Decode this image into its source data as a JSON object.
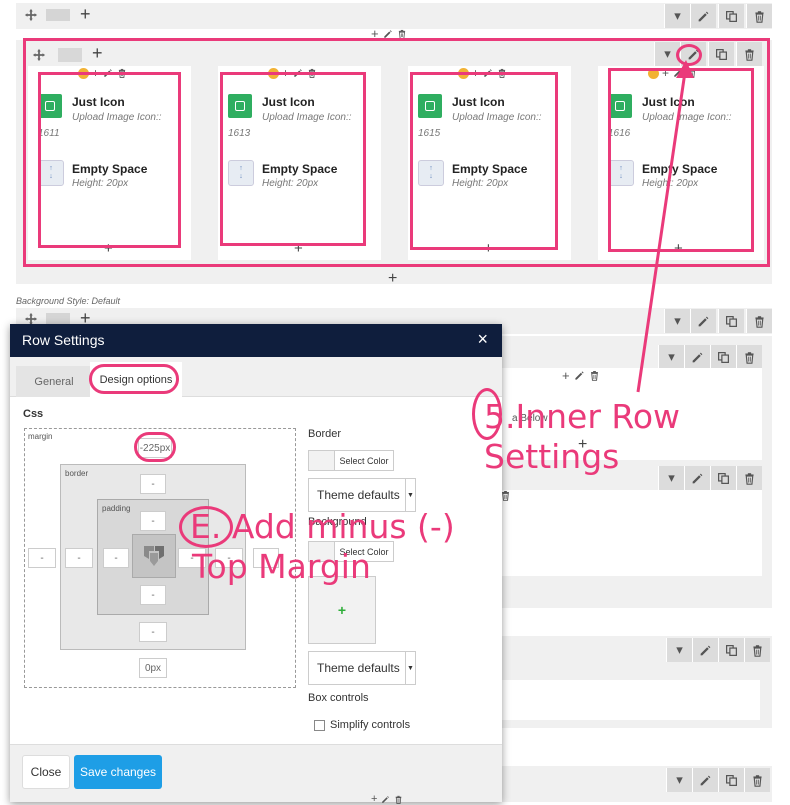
{
  "section_title": "Background Style: Default",
  "row_controls": {
    "add": "+",
    "dropdown": "▾",
    "move_icon": "move-icon",
    "pencil_icon": "pencil-icon",
    "copy_icon": "copy-icon",
    "trash_icon": "trash-icon"
  },
  "columns": [
    {
      "el1_title": "Just Icon",
      "el1_sub": "Upload Image Icon::",
      "el1_id": "1611",
      "el2_title": "Empty Space",
      "el2_sub": "Height: 20px"
    },
    {
      "el1_title": "Just Icon",
      "el1_sub": "Upload Image Icon::",
      "el1_id": "1613",
      "el2_title": "Empty Space",
      "el2_sub": "Height: 20px"
    },
    {
      "el1_title": "Just Icon",
      "el1_sub": "Upload Image Icon::",
      "el1_id": "1615",
      "el2_title": "Empty Space",
      "el2_sub": "Height: 20px"
    },
    {
      "el1_title": "Just Icon",
      "el1_sub": "Upload Image Icon::",
      "el1_id": "1616",
      "el2_title": "Empty Space",
      "el2_sub": "Height: 20px"
    }
  ],
  "modal": {
    "title": "Row Settings",
    "close": "×",
    "tabs": [
      "General",
      "Design options"
    ],
    "css_label": "Css",
    "margin_label": "margin",
    "border_label": "border",
    "padding_label": "padding",
    "margin_top_value": "-225px",
    "margin_bottom_value": "0px",
    "placeholder": "-",
    "border_heading": "Border",
    "select_color": "Select Color",
    "theme_defaults": "Theme defaults",
    "background_heading": "Background",
    "box_controls": "Box controls",
    "simplify_controls": "Simplify controls",
    "close_button": "Close",
    "save_button": "Save changes"
  },
  "annotations": {
    "step5_line1": "5.Inner Row",
    "step5_line2": "Settings",
    "stepE_line1": "E. Add minus (-)",
    "stepE_line2": "Top Margin",
    "color": "#ea3a7a"
  },
  "partial_text": "a Below"
}
